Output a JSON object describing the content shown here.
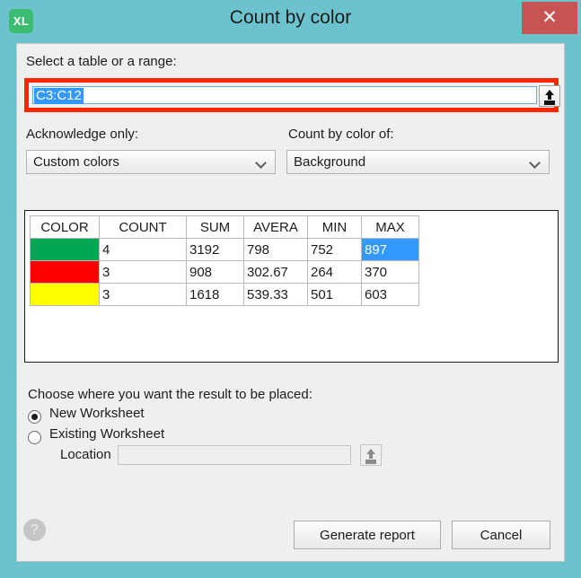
{
  "titlebar": {
    "app_icon_text": "XL",
    "title": "Count by color",
    "close_label": "✕"
  },
  "range_section": {
    "label": "Select a table or a range:",
    "value": "C3:C12",
    "placeholder": "",
    "picker_icon": "range-picker-icon"
  },
  "options": {
    "acknowledge_label": "Acknowledge only:",
    "acknowledge_value": "Custom colors",
    "count_by_label": "Count by color of:",
    "count_by_value": "Background"
  },
  "result_table": {
    "headers": [
      "COLOR",
      "COUNT",
      "SUM",
      "AVERA",
      "MIN",
      "MAX"
    ],
    "rows": [
      {
        "color": "#00a651",
        "count": "4",
        "sum": "3192",
        "average": "798",
        "min": "752",
        "max": "897",
        "max_selected": true
      },
      {
        "color": "#ff0000",
        "count": "3",
        "sum": "908",
        "average": "302.67",
        "min": "264",
        "max": "370",
        "max_selected": false
      },
      {
        "color": "#ffff00",
        "count": "3",
        "sum": "1618",
        "average": "539.33",
        "min": "501",
        "max": "603",
        "max_selected": false
      }
    ],
    "selection_color": "#3399ff"
  },
  "placement": {
    "heading": "Choose where you want the result to be placed:",
    "new_worksheet_label": "New Worksheet",
    "existing_worksheet_label": "Existing Worksheet",
    "new_worksheet_selected": true,
    "existing_worksheet_selected": false,
    "location_label": "Location",
    "location_value": "",
    "location_picker_icon": "range-picker-icon"
  },
  "footer": {
    "help_icon": "?",
    "generate_label": "Generate report",
    "cancel_label": "Cancel"
  },
  "colors": {
    "window_chrome": "#6cc3ce",
    "dialog_bg": "#efeff0",
    "close_button": "#c75453",
    "highlight_frame": "#fa2600",
    "app_icon": "#3cbc72"
  }
}
